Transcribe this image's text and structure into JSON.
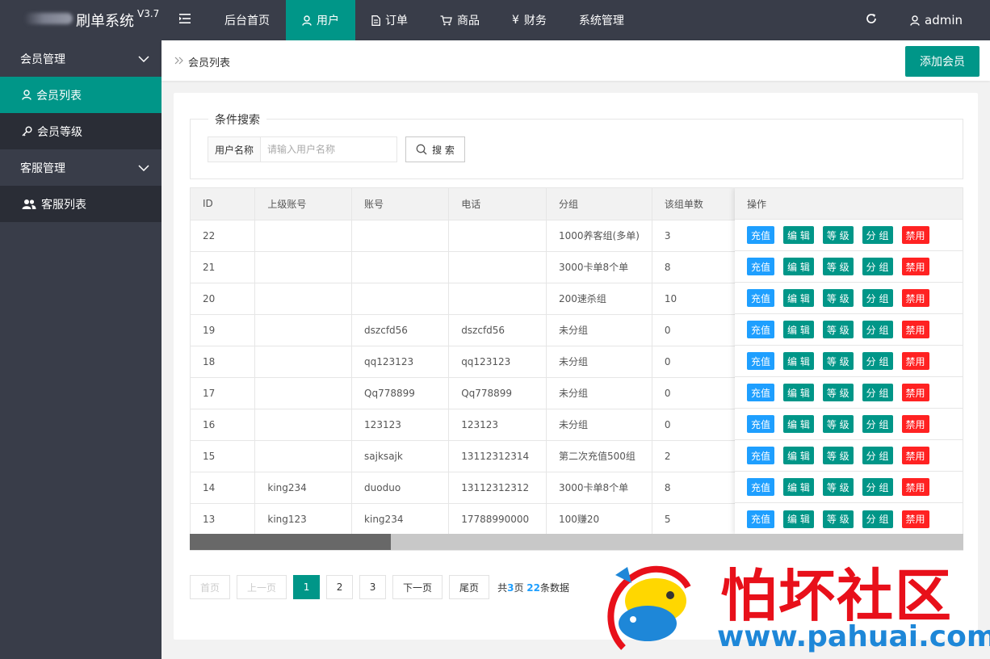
{
  "app": {
    "title": "刷单系统",
    "version": "V3.7"
  },
  "topnav": {
    "toggle_icon": "menu-fold-icon",
    "items": [
      {
        "label": "后台首页",
        "icon": "",
        "active": false
      },
      {
        "label": "用户",
        "icon": "user-icon",
        "active": true
      },
      {
        "label": "订单",
        "icon": "document-icon",
        "active": false
      },
      {
        "label": "商品",
        "icon": "cart-icon",
        "active": false
      },
      {
        "label": "财务",
        "icon": "yen-icon",
        "active": false,
        "glyph": "¥"
      },
      {
        "label": "系统管理",
        "icon": "",
        "active": false
      }
    ],
    "refresh_icon": "refresh-icon",
    "user": {
      "name": "admin",
      "icon": "user-icon"
    }
  },
  "sidebar": {
    "groups": [
      {
        "label": "会员管理",
        "icon": "chevron-down-icon",
        "items": [
          {
            "label": "会员列表",
            "icon": "user-icon",
            "active": true
          },
          {
            "label": "会员等级",
            "icon": "key-icon",
            "active": false
          }
        ]
      },
      {
        "label": "客服管理",
        "icon": "chevron-down-icon",
        "items": [
          {
            "label": "客服列表",
            "icon": "users-icon",
            "active": false
          }
        ]
      }
    ]
  },
  "breadcrumb": {
    "icon": "double-chevron-right-icon",
    "label": "会员列表"
  },
  "actions": {
    "add_label": "添加会员"
  },
  "search": {
    "legend": "条件搜索",
    "field_label": "用户名称",
    "placeholder": "请输入用户名称",
    "button_label": "搜 索"
  },
  "table": {
    "columns": [
      "ID",
      "上级账号",
      "账号",
      "电话",
      "分组",
      "该组单数",
      "操作"
    ],
    "rows": [
      [
        "22",
        "",
        "",
        "",
        "1000养客组(多单)",
        "3"
      ],
      [
        "21",
        "",
        "",
        "",
        "3000卡单8个单",
        "8"
      ],
      [
        "20",
        "",
        "",
        "",
        "200速杀组",
        "10"
      ],
      [
        "19",
        "",
        "dszcfd56",
        "dszcfd56",
        "未分组",
        "0"
      ],
      [
        "18",
        "",
        "qq123123",
        "qq123123",
        "未分组",
        "0"
      ],
      [
        "17",
        "",
        "Qq778899",
        "Qq778899",
        "未分组",
        "0"
      ],
      [
        "16",
        "",
        "123123",
        "123123",
        "未分组",
        "0"
      ],
      [
        "15",
        "",
        "sajksajk",
        "13112312314",
        "第二次充值500组",
        "2"
      ],
      [
        "14",
        "king234",
        "duoduo",
        "13112312312",
        "3000卡单8个单",
        "8"
      ],
      [
        "13",
        "king123",
        "king234",
        "17788990000",
        "100赚20",
        "5"
      ]
    ],
    "row_actions": [
      {
        "label": "充值",
        "color": "#1e9fff"
      },
      {
        "label": "编 辑",
        "color": "#009688"
      },
      {
        "label": "等 级",
        "color": "#009688"
      },
      {
        "label": "分 组",
        "color": "#009688"
      },
      {
        "label": "禁用",
        "color": "#ff2222"
      }
    ],
    "scroll_fraction": 0.26
  },
  "pagination": {
    "first": "首页",
    "prev": "上一页",
    "next": "下一页",
    "last": "尾页",
    "pages": [
      "1",
      "2",
      "3"
    ],
    "current": "1",
    "info_prefix": "共",
    "total_pages": "3",
    "info_mid": "页 ",
    "total_records": "22",
    "info_suffix": "条数据"
  },
  "watermark": {
    "text": "怕坏社区",
    "url": "www.pahuai.com"
  },
  "colors": {
    "topbar": "#393d49",
    "accent": "#009688",
    "blue": "#1e9fff",
    "red": "#ff2222"
  }
}
